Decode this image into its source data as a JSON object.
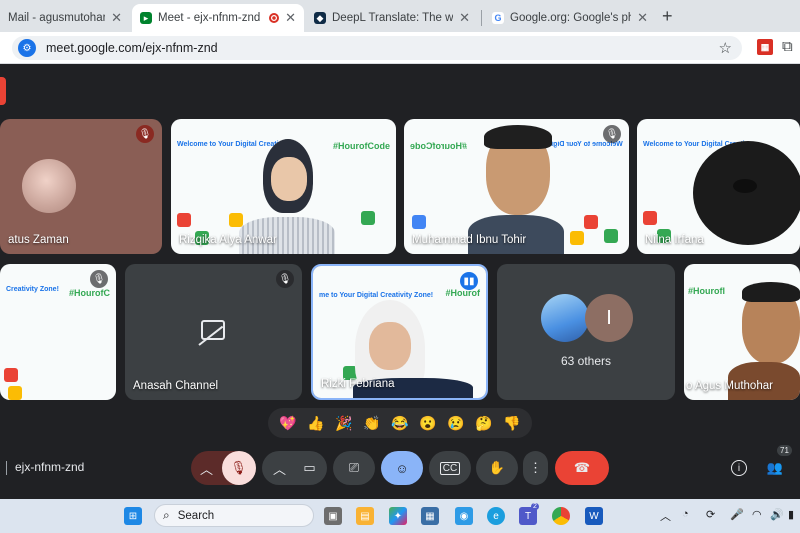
{
  "tabs": [
    {
      "title": "Mail - agusmutohar@walis",
      "closable": true,
      "favicon": "mail-icon"
    },
    {
      "title": "Meet - ejx-nfnm-znd",
      "closable": true,
      "favicon": "meet-icon",
      "active": true,
      "recording": true
    },
    {
      "title": "DeepL Translate: The world's m",
      "closable": true,
      "favicon": "deepl-icon"
    },
    {
      "title": "Google.org: Google's philanthr",
      "closable": true,
      "favicon": "google-icon"
    }
  ],
  "new_tab_label": "+",
  "address": {
    "url": "meet.google.com/ejx-nfnm-znd"
  },
  "participants_row1": [
    {
      "name": "atus Zaman",
      "muted": true
    },
    {
      "name": "Rizqika Alya Anwar",
      "muted": false,
      "slide_header": "Welcome to Your Digital Creativity",
      "slide_tag": "#HourofCode"
    },
    {
      "name": "Muhammad Ibnu Tohir",
      "muted": true,
      "slide_header": "Welcome to Your Digital",
      "slide_tag": "#HourofCode"
    },
    {
      "name": "Nilna Irfana",
      "muted": false,
      "slide_header": "Welcome to Your Digital Creativ"
    }
  ],
  "participants_row2": [
    {
      "name": "",
      "muted": true,
      "slide_header": "Creativity Zone!",
      "slide_tag": "#HourofC"
    },
    {
      "name": "Anasah Channel",
      "muted": true
    },
    {
      "name": "Rizki Febriana",
      "muted": false,
      "speaking": true,
      "slide_header": "me to Your Digital Creativity Zone!",
      "slide_tag": "#Hourof"
    },
    {
      "name": "63 others",
      "others_initial": "I"
    },
    {
      "name": "o Agus Muthohar",
      "muted": false,
      "slide_tag": "#Hourofl"
    }
  ],
  "reactions": [
    "💖",
    "👍",
    "🎉",
    "👏",
    "😂",
    "😮",
    "😢",
    "🤔",
    "👎"
  ],
  "meeting_code": "ejx-nfnm-znd",
  "participant_count": "71",
  "taskbar": {
    "search_placeholder": "Search",
    "teams_badge": "2"
  },
  "colors": {
    "meet_bg": "#202124",
    "tile_bg": "#3c4043",
    "end_call": "#ea4335",
    "accent_blue": "#8ab4f8"
  }
}
